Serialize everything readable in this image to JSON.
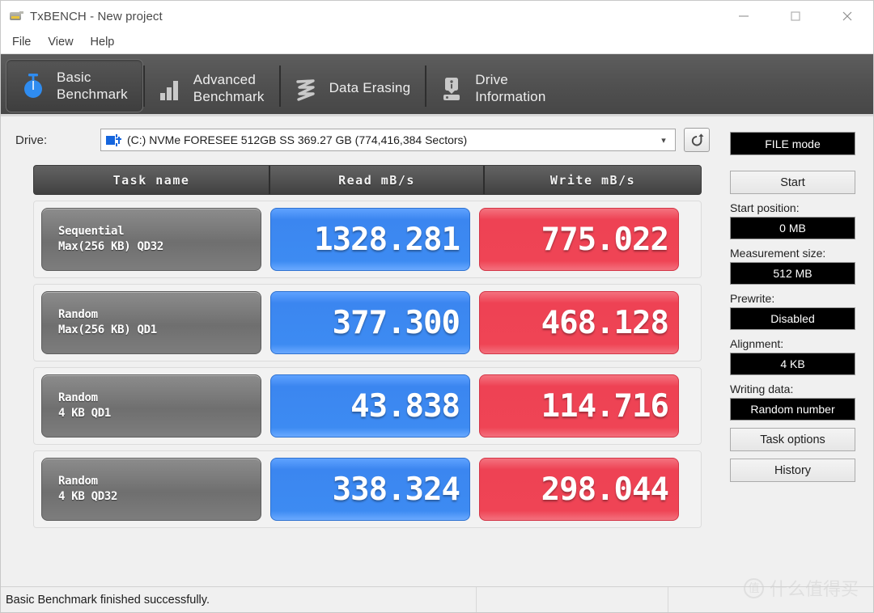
{
  "window": {
    "title": "TxBENCH - New project",
    "icon": "app-icon",
    "controls": [
      {
        "name": "minimize",
        "glyph": "minimize-icon"
      },
      {
        "name": "maximize",
        "glyph": "maximize-icon"
      },
      {
        "name": "close",
        "glyph": "close-icon"
      }
    ]
  },
  "menu": {
    "items": [
      {
        "label": "File"
      },
      {
        "label": "View"
      },
      {
        "label": "Help"
      }
    ]
  },
  "tabs": [
    {
      "label": "Basic\nBenchmark",
      "icon": "stopwatch-icon",
      "active": true
    },
    {
      "label": "Advanced\nBenchmark",
      "icon": "bar-chart-icon",
      "active": false
    },
    {
      "label": "Data Erasing",
      "icon": "shred-icon",
      "active": false
    },
    {
      "label": "Drive\nInformation",
      "icon": "drive-info-icon",
      "active": false
    }
  ],
  "drive": {
    "label": "Drive:",
    "selected": "(C:) NVMe FORESEE 512GB SS  369.27 GB (774,416,384 Sectors)",
    "dropdown_arrow": "chevron-down-icon",
    "refresh_icon": "refresh-icon"
  },
  "benchmark": {
    "columns": [
      "Task name",
      "Read mB/s",
      "Write mB/s"
    ],
    "rows": [
      {
        "task_line1": "Sequential",
        "task_line2": "Max(256 KB) QD32",
        "read": "1328.281",
        "write": "775.022"
      },
      {
        "task_line1": "Random",
        "task_line2": "Max(256 KB) QD1",
        "read": "377.300",
        "write": "468.128"
      },
      {
        "task_line1": "Random",
        "task_line2": "4 KB QD1",
        "read": "43.838",
        "write": "114.716"
      },
      {
        "task_line1": "Random",
        "task_line2": "4 KB QD32",
        "read": "338.324",
        "write": "298.044"
      }
    ]
  },
  "sidebar": {
    "mode": "FILE mode",
    "start_button": "Start",
    "fields": [
      {
        "label": "Start position:",
        "value": "0 MB"
      },
      {
        "label": "Measurement size:",
        "value": "512 MB"
      },
      {
        "label": "Prewrite:",
        "value": "Disabled"
      },
      {
        "label": "Alignment:",
        "value": "4 KB"
      },
      {
        "label": "Writing data:",
        "value": "Random number"
      }
    ],
    "task_options_button": "Task options",
    "history_button": "History"
  },
  "statusbar": {
    "message": "Basic Benchmark finished successfully."
  },
  "watermark": {
    "badge": "值",
    "text": "什么值得买"
  },
  "colors": {
    "read_chip": "#3d8bf2",
    "write_chip": "#ef4455",
    "task_chip": "#7d7d7d",
    "tabstrip": "#4f4f4f",
    "window_bg": "#f0f0f0"
  }
}
